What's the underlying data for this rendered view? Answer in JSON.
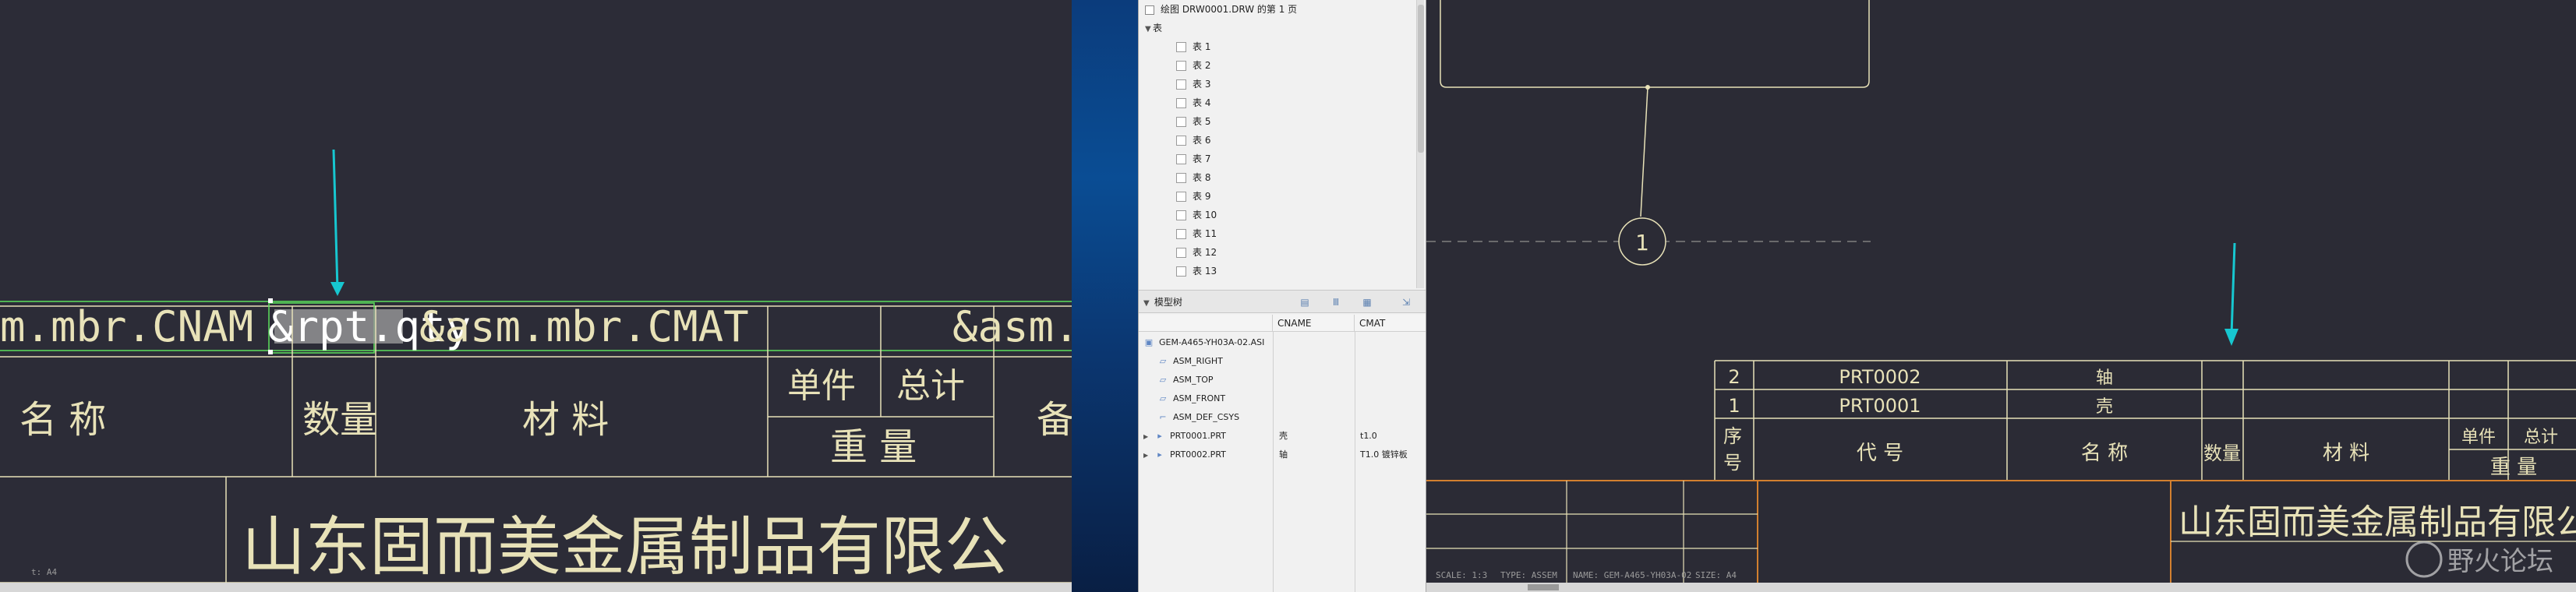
{
  "left_view": {
    "top_row": {
      "cname_param": "m.mbr.CNAM",
      "qty_param": "&rpt.qty",
      "cmat_param": "&asm.mbr.CMAT",
      "cmat_param2": "&asm.m"
    },
    "headers": {
      "name": "名    称",
      "qty": "数量",
      "material": "材 料",
      "unit": "单件",
      "total": "总计",
      "weight": "重 量",
      "cut": "备"
    },
    "company": "山东固而美金属制品有限公",
    "status_text": "t: A4"
  },
  "model_tree": {
    "header_title": "绘图 DRW0001.DRW 的第 1 页",
    "tables_label": "表",
    "tables": [
      "表 1",
      "表 2",
      "表 3",
      "表 4",
      "表 5",
      "表 6",
      "表 7",
      "表 8",
      "表 9",
      "表 10",
      "表 11",
      "表 12",
      "表 13"
    ],
    "section_title": "模型树",
    "columns": [
      "CNAME",
      "CMAT"
    ],
    "items": [
      {
        "name": "GEM-A465-YH03A-02.ASI",
        "cname": "",
        "cmat": ""
      },
      {
        "name": "ASM_RIGHT",
        "cname": "",
        "cmat": ""
      },
      {
        "name": "ASM_TOP",
        "cname": "",
        "cmat": ""
      },
      {
        "name": "ASM_FRONT",
        "cname": "",
        "cmat": ""
      },
      {
        "name": "ASM_DEF_CSYS",
        "cname": "",
        "cmat": ""
      },
      {
        "name": "PRT0001.PRT",
        "cname": "壳",
        "cmat": "t1.0"
      },
      {
        "name": "PRT0002.PRT",
        "cname": "轴",
        "cmat": "T1.0 镀锌板"
      }
    ]
  },
  "right_view": {
    "balloon": "1",
    "bom_rows": [
      {
        "index": "2",
        "code": "PRT0002",
        "name": "轴"
      },
      {
        "index": "1",
        "code": "PRT0001",
        "name": "壳"
      }
    ],
    "headers": {
      "index": "序号",
      "code": "代    号",
      "name": "名    称",
      "qty": "数量",
      "material": "材 料",
      "unit": "单件",
      "total": "总计",
      "weight": "重 量"
    },
    "company": "山东固而美金属制品有限公",
    "status": {
      "scale": "SCALE: 1:3",
      "type": "TYPE: ASSEM",
      "name": "NAME: GEM-A465-YH03A-02",
      "size": "SIZE: A4"
    },
    "watermark": "野火论坛"
  },
  "colors": {
    "drawing_line": "#e8e2b8",
    "frame_line": "#d3802f",
    "arrow": "#17c7d0",
    "highlight": "#5de05d",
    "background": "#2b2b36"
  }
}
